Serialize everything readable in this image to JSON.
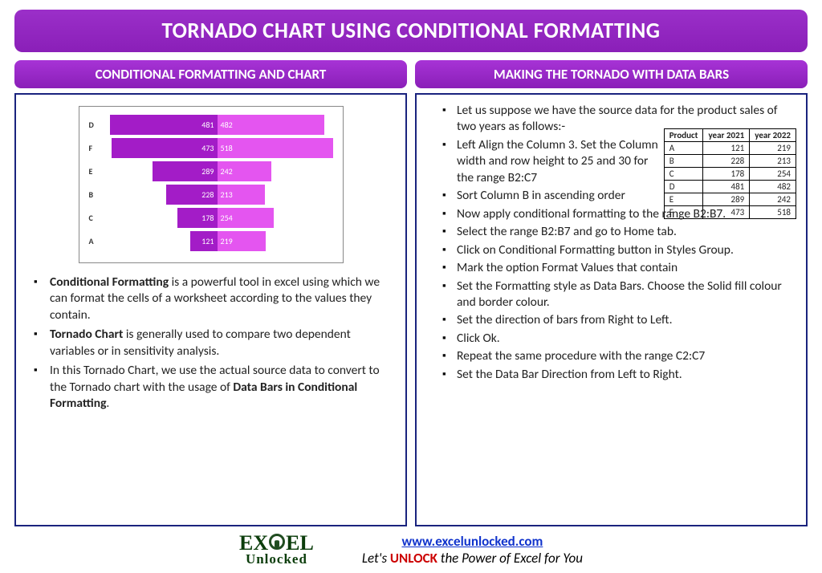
{
  "title": "TORNADO CHART USING CONDITIONAL FORMATTING",
  "left": {
    "header": "CONDITIONAL FORMATTING AND CHART",
    "bullets": {
      "b1_strong": "Conditional Formatting",
      "b1_rest": " is a powerful tool in excel using which we can format the cells of a worksheet according to the values they contain.",
      "b2_strong": "Tornado Chart",
      "b2_rest": " is generally used to compare two dependent variables or in sensitivity analysis.",
      "b3_a": "In this Tornado Chart, we use the actual source data to convert to the Tornado chart with the usage of ",
      "b3_strong": "Data Bars in Conditional Formatting",
      "b3_b": "."
    }
  },
  "right": {
    "header": "MAKING THE TORNADO WITH DATA BARS",
    "steps": {
      "s1": "Let us suppose we have the source data for the product sales of two years as follows:-",
      "s2": "Left Align the Column 3. Set the Column width and row height to 25 and 30 for the range B2:C7",
      "s3": "Sort Column B in ascending order",
      "s4": "Now apply conditional formatting to the range B2:B7.",
      "s5": "Select the range B2:B7 and go to Home tab.",
      "s6": "Click on Conditional Formatting button in Styles Group.",
      "s7": "Mark the option Format Values that contain",
      "s8": "Set the Formatting style as Data Bars. Choose the Solid fill colour and border colour.",
      "s9": "Set the direction of bars from Right to Left.",
      "s10": "Click Ok.",
      "s11": "Repeat the same procedure with the range C2:C7",
      "s12": "Set the Data Bar Direction from Left to Right."
    }
  },
  "chart_data": {
    "type": "bar",
    "title": "",
    "categories": [
      "D",
      "F",
      "E",
      "B",
      "C",
      "A"
    ],
    "series": [
      {
        "name": "year 2021",
        "values": [
          481,
          473,
          289,
          228,
          178,
          121
        ]
      },
      {
        "name": "year 2022",
        "values": [
          482,
          518,
          242,
          213,
          254,
          219
        ]
      }
    ],
    "max": 518,
    "xlabel": "",
    "ylabel": ""
  },
  "source_table": {
    "headers": {
      "c1": "Product",
      "c2": "year 2021",
      "c3": "year 2022"
    },
    "rows": [
      {
        "p": "A",
        "y1": "121",
        "y2": "219"
      },
      {
        "p": "B",
        "y1": "228",
        "y2": "213"
      },
      {
        "p": "C",
        "y1": "178",
        "y2": "254"
      },
      {
        "p": "D",
        "y1": "481",
        "y2": "482"
      },
      {
        "p": "E",
        "y1": "289",
        "y2": "242"
      },
      {
        "p": "F",
        "y1": "473",
        "y2": "518"
      }
    ]
  },
  "footer": {
    "logo_top": "EXCEL",
    "logo_bottom": "Unlocked",
    "url": "www.excelunlocked.com",
    "tagline_a": "Let's ",
    "tagline_b": "UNLOCK",
    "tagline_c": " the Power of Excel for You"
  }
}
